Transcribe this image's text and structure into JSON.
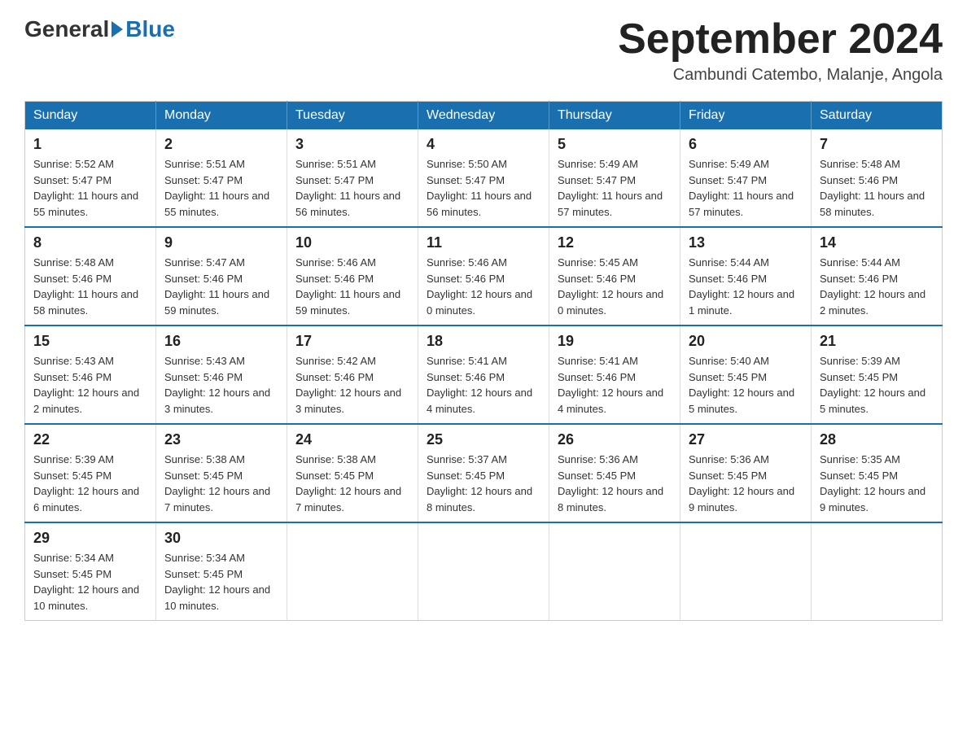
{
  "header": {
    "logo_general": "General",
    "logo_blue": "Blue",
    "month_year": "September 2024",
    "location": "Cambundi Catembo, Malanje, Angola"
  },
  "days_of_week": [
    "Sunday",
    "Monday",
    "Tuesday",
    "Wednesday",
    "Thursday",
    "Friday",
    "Saturday"
  ],
  "weeks": [
    [
      {
        "day": "1",
        "sunrise": "5:52 AM",
        "sunset": "5:47 PM",
        "daylight": "11 hours and 55 minutes."
      },
      {
        "day": "2",
        "sunrise": "5:51 AM",
        "sunset": "5:47 PM",
        "daylight": "11 hours and 55 minutes."
      },
      {
        "day": "3",
        "sunrise": "5:51 AM",
        "sunset": "5:47 PM",
        "daylight": "11 hours and 56 minutes."
      },
      {
        "day": "4",
        "sunrise": "5:50 AM",
        "sunset": "5:47 PM",
        "daylight": "11 hours and 56 minutes."
      },
      {
        "day": "5",
        "sunrise": "5:49 AM",
        "sunset": "5:47 PM",
        "daylight": "11 hours and 57 minutes."
      },
      {
        "day": "6",
        "sunrise": "5:49 AM",
        "sunset": "5:47 PM",
        "daylight": "11 hours and 57 minutes."
      },
      {
        "day": "7",
        "sunrise": "5:48 AM",
        "sunset": "5:46 PM",
        "daylight": "11 hours and 58 minutes."
      }
    ],
    [
      {
        "day": "8",
        "sunrise": "5:48 AM",
        "sunset": "5:46 PM",
        "daylight": "11 hours and 58 minutes."
      },
      {
        "day": "9",
        "sunrise": "5:47 AM",
        "sunset": "5:46 PM",
        "daylight": "11 hours and 59 minutes."
      },
      {
        "day": "10",
        "sunrise": "5:46 AM",
        "sunset": "5:46 PM",
        "daylight": "11 hours and 59 minutes."
      },
      {
        "day": "11",
        "sunrise": "5:46 AM",
        "sunset": "5:46 PM",
        "daylight": "12 hours and 0 minutes."
      },
      {
        "day": "12",
        "sunrise": "5:45 AM",
        "sunset": "5:46 PM",
        "daylight": "12 hours and 0 minutes."
      },
      {
        "day": "13",
        "sunrise": "5:44 AM",
        "sunset": "5:46 PM",
        "daylight": "12 hours and 1 minute."
      },
      {
        "day": "14",
        "sunrise": "5:44 AM",
        "sunset": "5:46 PM",
        "daylight": "12 hours and 2 minutes."
      }
    ],
    [
      {
        "day": "15",
        "sunrise": "5:43 AM",
        "sunset": "5:46 PM",
        "daylight": "12 hours and 2 minutes."
      },
      {
        "day": "16",
        "sunrise": "5:43 AM",
        "sunset": "5:46 PM",
        "daylight": "12 hours and 3 minutes."
      },
      {
        "day": "17",
        "sunrise": "5:42 AM",
        "sunset": "5:46 PM",
        "daylight": "12 hours and 3 minutes."
      },
      {
        "day": "18",
        "sunrise": "5:41 AM",
        "sunset": "5:46 PM",
        "daylight": "12 hours and 4 minutes."
      },
      {
        "day": "19",
        "sunrise": "5:41 AM",
        "sunset": "5:46 PM",
        "daylight": "12 hours and 4 minutes."
      },
      {
        "day": "20",
        "sunrise": "5:40 AM",
        "sunset": "5:45 PM",
        "daylight": "12 hours and 5 minutes."
      },
      {
        "day": "21",
        "sunrise": "5:39 AM",
        "sunset": "5:45 PM",
        "daylight": "12 hours and 5 minutes."
      }
    ],
    [
      {
        "day": "22",
        "sunrise": "5:39 AM",
        "sunset": "5:45 PM",
        "daylight": "12 hours and 6 minutes."
      },
      {
        "day": "23",
        "sunrise": "5:38 AM",
        "sunset": "5:45 PM",
        "daylight": "12 hours and 7 minutes."
      },
      {
        "day": "24",
        "sunrise": "5:38 AM",
        "sunset": "5:45 PM",
        "daylight": "12 hours and 7 minutes."
      },
      {
        "day": "25",
        "sunrise": "5:37 AM",
        "sunset": "5:45 PM",
        "daylight": "12 hours and 8 minutes."
      },
      {
        "day": "26",
        "sunrise": "5:36 AM",
        "sunset": "5:45 PM",
        "daylight": "12 hours and 8 minutes."
      },
      {
        "day": "27",
        "sunrise": "5:36 AM",
        "sunset": "5:45 PM",
        "daylight": "12 hours and 9 minutes."
      },
      {
        "day": "28",
        "sunrise": "5:35 AM",
        "sunset": "5:45 PM",
        "daylight": "12 hours and 9 minutes."
      }
    ],
    [
      {
        "day": "29",
        "sunrise": "5:34 AM",
        "sunset": "5:45 PM",
        "daylight": "12 hours and 10 minutes."
      },
      {
        "day": "30",
        "sunrise": "5:34 AM",
        "sunset": "5:45 PM",
        "daylight": "12 hours and 10 minutes."
      },
      null,
      null,
      null,
      null,
      null
    ]
  ],
  "labels": {
    "sunrise": "Sunrise:",
    "sunset": "Sunset:",
    "daylight": "Daylight:"
  }
}
